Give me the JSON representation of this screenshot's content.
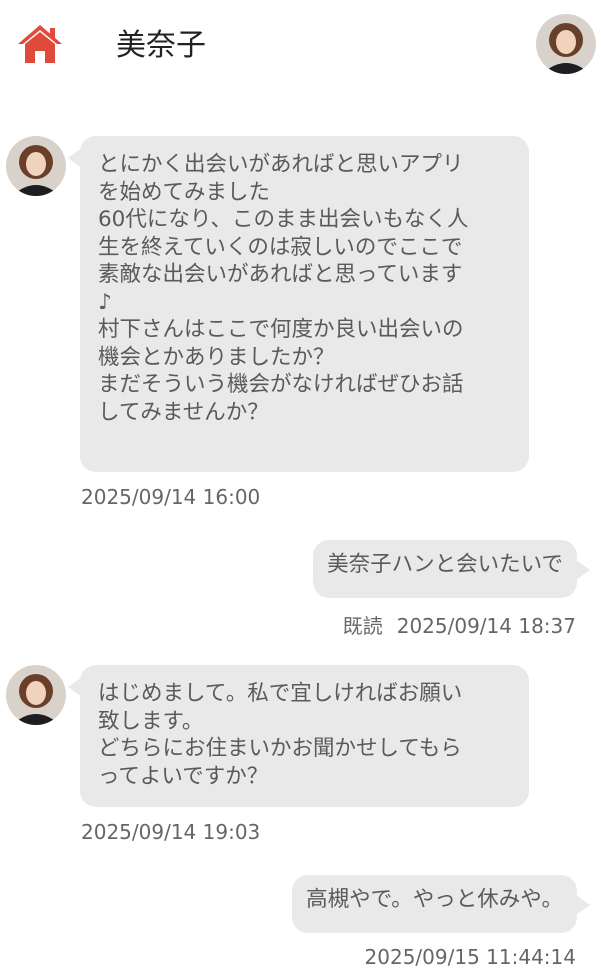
{
  "header": {
    "title": "美奈子",
    "home_icon": "home-icon",
    "accent_color": "#e04a3a"
  },
  "messages": [
    {
      "direction": "incoming",
      "text": "とにかく出会いがあればと思いアプリ\nを始めてみました\n60代になり、このまま出会いもなく人\n生を終えていくのは寂しいのでここで\n素敵な出会いがあればと思っています\n♪\n村下さんはここで何度か良い出会いの\n機会とかありましたか？\nまだそういう機会がなければぜひお話\nしてみませんか？",
      "timestamp": "2025/09/14 16:00"
    },
    {
      "direction": "outgoing",
      "text": "美奈子ハンと会いたいで",
      "read_label": "既読",
      "timestamp": "2025/09/14 18:37"
    },
    {
      "direction": "incoming",
      "text": "はじめまして。私で宜しければお願い\n致します。\nどちらにお住まいかお聞かせしてもら\nってよいですか？",
      "timestamp": "2025/09/14 19:03"
    },
    {
      "direction": "outgoing",
      "text": "高槻やで。やっと休みや。",
      "timestamp": "2025/09/15 11:44:14"
    }
  ]
}
